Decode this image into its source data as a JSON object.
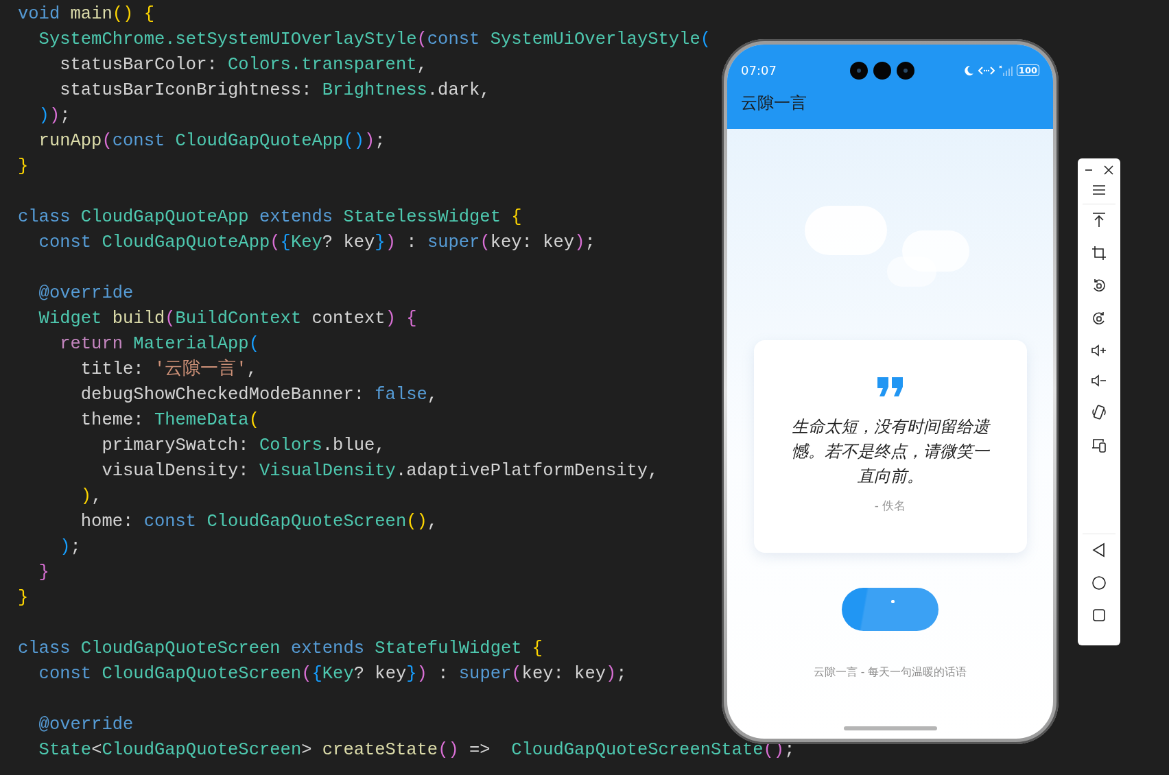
{
  "editor": {
    "blocks": [
      [
        {
          "tokens": [
            {
              "kind": "keyword",
              "text": "void"
            },
            {
              "kind": "function",
              "text": " main"
            },
            {
              "kind": "bracket1",
              "text": "() {"
            }
          ]
        },
        {
          "tokens": [
            {
              "kind": "type",
              "text": "  SystemChrome.setSystemUIOverlayStyle"
            },
            {
              "kind": "bracket2",
              "text": "("
            },
            {
              "kind": "keyword",
              "text": "const "
            },
            {
              "kind": "type",
              "text": "SystemUiOverlayStyle"
            },
            {
              "kind": "bracket3",
              "text": "("
            }
          ]
        },
        {
          "tokens": [
            {
              "kind": "plain",
              "text": "    statusBarColor: "
            },
            {
              "kind": "type",
              "text": "Colors.transparent"
            },
            {
              "kind": "plain",
              "text": ","
            }
          ]
        },
        {
          "tokens": [
            {
              "kind": "plain",
              "text": "    statusBarIconBrightness: "
            },
            {
              "kind": "type",
              "text": "Brightness"
            },
            {
              "kind": "plain",
              "text": ".dark,"
            }
          ]
        },
        {
          "tokens": [
            {
              "kind": "bracket3",
              "text": "  )"
            },
            {
              "kind": "bracket2",
              "text": ")"
            },
            {
              "kind": "plain",
              "text": ";"
            }
          ]
        },
        {
          "tokens": [
            {
              "kind": "function",
              "text": "  runApp"
            },
            {
              "kind": "bracket2",
              "text": "("
            },
            {
              "kind": "keyword",
              "text": "const "
            },
            {
              "kind": "type",
              "text": "CloudGapQuoteApp"
            },
            {
              "kind": "bracket3",
              "text": "()"
            },
            {
              "kind": "bracket2",
              "text": ")"
            },
            {
              "kind": "plain",
              "text": ";"
            }
          ]
        },
        {
          "tokens": [
            {
              "kind": "bracket1",
              "text": "}"
            }
          ]
        }
      ],
      [
        {
          "tokens": [
            {
              "kind": "keyword",
              "text": "class "
            },
            {
              "kind": "type",
              "text": "CloudGapQuoteApp "
            },
            {
              "kind": "keyword",
              "text": "extends "
            },
            {
              "kind": "type",
              "text": "StatelessWidget "
            },
            {
              "kind": "bracket1",
              "text": "{"
            }
          ]
        },
        {
          "tokens": [
            {
              "kind": "keyword",
              "text": "  const "
            },
            {
              "kind": "type",
              "text": "CloudGapQuoteApp"
            },
            {
              "kind": "bracket2",
              "text": "("
            },
            {
              "kind": "bracket3",
              "text": "{"
            },
            {
              "kind": "type",
              "text": "Key"
            },
            {
              "kind": "plain",
              "text": "? key"
            },
            {
              "kind": "bracket3",
              "text": "}"
            },
            {
              "kind": "bracket2",
              "text": ")"
            },
            {
              "kind": "plain",
              "text": " : "
            },
            {
              "kind": "keyword",
              "text": "super"
            },
            {
              "kind": "bracket2",
              "text": "("
            },
            {
              "kind": "plain",
              "text": "key: key"
            },
            {
              "kind": "bracket2",
              "text": ")"
            },
            {
              "kind": "plain",
              "text": ";"
            }
          ]
        }
      ],
      [
        {
          "tokens": [
            {
              "kind": "keyword",
              "text": "  @override"
            }
          ]
        },
        {
          "tokens": [
            {
              "kind": "type",
              "text": "  Widget "
            },
            {
              "kind": "function",
              "text": "build"
            },
            {
              "kind": "bracket2",
              "text": "("
            },
            {
              "kind": "type",
              "text": "BuildContext "
            },
            {
              "kind": "plain",
              "text": "context"
            },
            {
              "kind": "bracket2",
              "text": ") {"
            }
          ]
        },
        {
          "tokens": [
            {
              "kind": "control",
              "text": "    return "
            },
            {
              "kind": "type",
              "text": "MaterialApp"
            },
            {
              "kind": "bracket3",
              "text": "("
            }
          ]
        },
        {
          "tokens": [
            {
              "kind": "plain",
              "text": "      title: "
            },
            {
              "kind": "string",
              "text": "'云隙一言'"
            },
            {
              "kind": "plain",
              "text": ","
            }
          ]
        },
        {
          "tokens": [
            {
              "kind": "plain",
              "text": "      debugShowCheckedModeBanner: "
            },
            {
              "kind": "keyword",
              "text": "false"
            },
            {
              "kind": "plain",
              "text": ","
            }
          ]
        },
        {
          "tokens": [
            {
              "kind": "plain",
              "text": "      theme: "
            },
            {
              "kind": "type",
              "text": "ThemeData"
            },
            {
              "kind": "bracket1",
              "text": "("
            }
          ]
        },
        {
          "tokens": [
            {
              "kind": "plain",
              "text": "        primarySwatch: "
            },
            {
              "kind": "type",
              "text": "Colors"
            },
            {
              "kind": "plain",
              "text": ".blue,"
            }
          ]
        },
        {
          "tokens": [
            {
              "kind": "plain",
              "text": "        visualDensity: "
            },
            {
              "kind": "type",
              "text": "VisualDensity"
            },
            {
              "kind": "plain",
              "text": ".adaptivePlatformDensity,"
            }
          ]
        },
        {
          "tokens": [
            {
              "kind": "bracket1",
              "text": "      )"
            },
            {
              "kind": "plain",
              "text": ","
            }
          ]
        },
        {
          "tokens": [
            {
              "kind": "plain",
              "text": "      home: "
            },
            {
              "kind": "keyword",
              "text": "const "
            },
            {
              "kind": "type",
              "text": "CloudGapQuoteScreen"
            },
            {
              "kind": "bracket1",
              "text": "()"
            },
            {
              "kind": "plain",
              "text": ","
            }
          ]
        },
        {
          "tokens": [
            {
              "kind": "bracket3",
              "text": "    )"
            },
            {
              "kind": "plain",
              "text": ";"
            }
          ]
        },
        {
          "tokens": [
            {
              "kind": "bracket2",
              "text": "  }"
            }
          ]
        },
        {
          "tokens": [
            {
              "kind": "bracket1",
              "text": "}"
            }
          ]
        }
      ],
      [
        {
          "tokens": [
            {
              "kind": "keyword",
              "text": "class "
            },
            {
              "kind": "type",
              "text": "CloudGapQuoteScreen "
            },
            {
              "kind": "keyword",
              "text": "extends "
            },
            {
              "kind": "type",
              "text": "StatefulWidget "
            },
            {
              "kind": "bracket1",
              "text": "{"
            }
          ]
        },
        {
          "tokens": [
            {
              "kind": "keyword",
              "text": "  const "
            },
            {
              "kind": "type",
              "text": "CloudGapQuoteScreen"
            },
            {
              "kind": "bracket2",
              "text": "("
            },
            {
              "kind": "bracket3",
              "text": "{"
            },
            {
              "kind": "type",
              "text": "Key"
            },
            {
              "kind": "plain",
              "text": "? key"
            },
            {
              "kind": "bracket3",
              "text": "}"
            },
            {
              "kind": "bracket2",
              "text": ")"
            },
            {
              "kind": "plain",
              "text": " : "
            },
            {
              "kind": "keyword",
              "text": "super"
            },
            {
              "kind": "bracket2",
              "text": "("
            },
            {
              "kind": "plain",
              "text": "key: key"
            },
            {
              "kind": "bracket2",
              "text": ")"
            },
            {
              "kind": "plain",
              "text": ";"
            }
          ]
        }
      ],
      [
        {
          "tokens": [
            {
              "kind": "keyword",
              "text": "  @override"
            }
          ]
        },
        {
          "tokens": [
            {
              "kind": "type",
              "text": "  State"
            },
            {
              "kind": "plain",
              "text": "<"
            },
            {
              "kind": "type",
              "text": "CloudGapQuoteScreen"
            },
            {
              "kind": "plain",
              "text": "> "
            },
            {
              "kind": "function",
              "text": "createState"
            },
            {
              "kind": "bracket2",
              "text": "()"
            },
            {
              "kind": "plain",
              "text": " =>  "
            },
            {
              "kind": "type",
              "text": "CloudGapQuoteScreenState"
            },
            {
              "kind": "bracket2",
              "text": "()"
            },
            {
              "kind": "plain",
              "text": ";"
            }
          ]
        }
      ]
    ]
  },
  "phone": {
    "status_bar": {
      "time": "07:07",
      "battery": "100"
    },
    "app_bar": {
      "title": "云隙一言"
    },
    "quote": {
      "text": "生命太短，没有时间留给遗憾。若不是终点，请微笑一直向前。",
      "author": "- 佚名"
    },
    "footer": "云隙一言 - 每天一句温暖的话语"
  }
}
